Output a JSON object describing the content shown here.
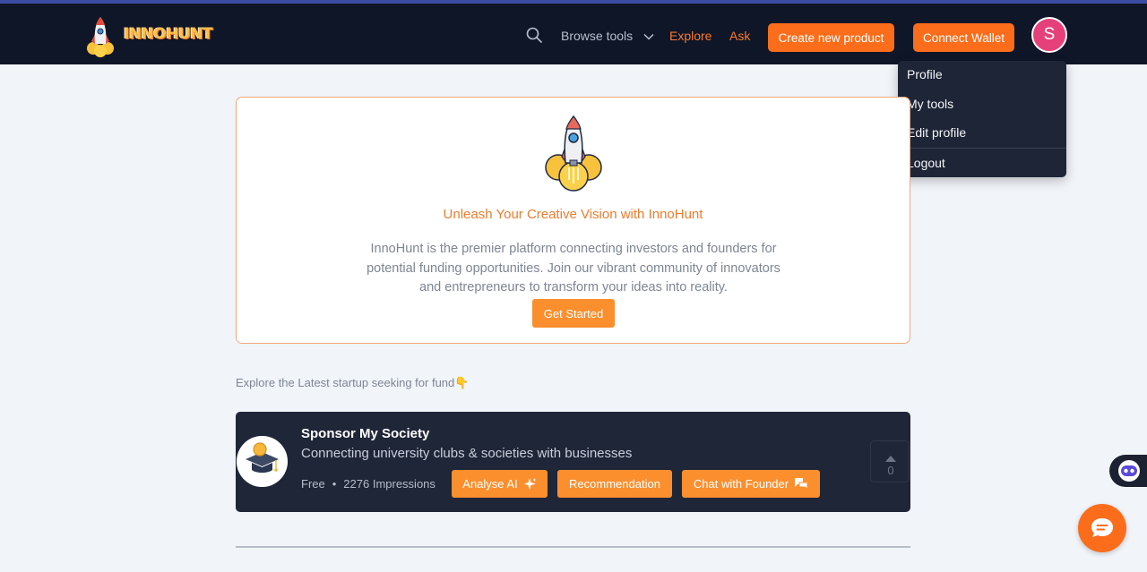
{
  "brand": {
    "name": "INNOHUNT"
  },
  "nav": {
    "browse_label": "Browse tools",
    "explore_label": "Explore",
    "ask_label": "Ask",
    "create_label": "Create new product",
    "wallet_label": "Connect Wallet",
    "avatar_initial": "S"
  },
  "dropdown": {
    "items": [
      "Profile",
      "My tools",
      "Edit profile",
      "Logout"
    ]
  },
  "hero": {
    "title": "Unleash Your Creative Vision with InnoHunt",
    "text": "InnoHunt is the premier platform connecting investors and founders for potential funding opportunities. Join our vibrant community of innovators and entrepreneurs to transform your ideas into reality.",
    "cta": "Get Started"
  },
  "section": {
    "label": "Explore the Latest startup seeking for fund👇"
  },
  "product": {
    "title": "Sponsor My Society",
    "subtitle": "Connecting university clubs & societies with businesses",
    "price": "Free",
    "impressions": "2276 Impressions",
    "analyse_label": "Analyse AI",
    "recommendation_label": "Recommendation",
    "chat_label": "Chat with Founder",
    "upvotes": "0"
  },
  "colors": {
    "navbar": "#0f1628",
    "accent": "#fb6d1b",
    "accent_light": "#fb8f2e",
    "card": "#1f2637",
    "avatar": "#e6407a"
  }
}
